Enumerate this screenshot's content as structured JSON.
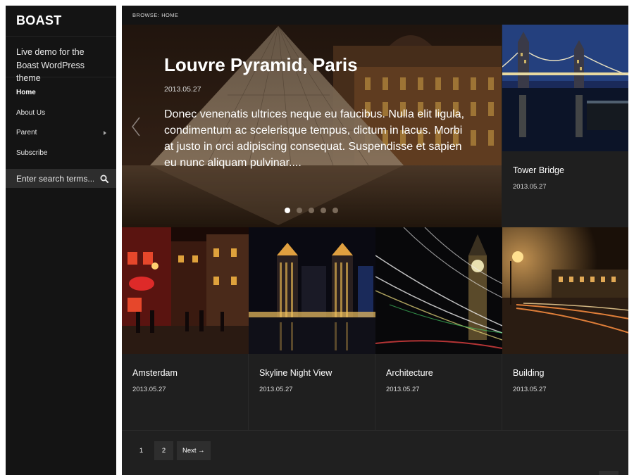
{
  "site": {
    "title": "BOAST",
    "description": "Live demo for the Boast WordPress theme"
  },
  "menu": {
    "items": [
      {
        "label": "Home"
      },
      {
        "label": "About Us"
      },
      {
        "label": "Parent"
      },
      {
        "label": "Subscribe"
      }
    ]
  },
  "search": {
    "placeholder": "Enter search terms...",
    "icon": "search-icon"
  },
  "breadcrumb": {
    "label": "Browse:",
    "current": "Home"
  },
  "featured": {
    "title": "Louvre Pyramid, Paris",
    "date": "2013.05.27",
    "excerpt": "Donec venenatis ultrices neque eu faucibus. Nulla elit ligula, condimentum ac scelerisque tempus, dictum in lacus. Morbi at justo in orci adipiscing consequat. Suspendisse et sapien eu nunc aliquam pulvinar....",
    "slide_count": 5,
    "active_slide": 1
  },
  "posts": [
    {
      "title": "Tower Bridge",
      "date": "2013.05.27"
    },
    {
      "title": "Amsterdam",
      "date": "2013.05.27"
    },
    {
      "title": "Skyline Night View",
      "date": "2013.05.27"
    },
    {
      "title": "Architecture",
      "date": "2013.05.27"
    },
    {
      "title": "Building",
      "date": "2013.05.27"
    }
  ],
  "pagination": {
    "pages": [
      "1",
      "2"
    ],
    "next_label": "Next →"
  },
  "colors": {
    "sidebar_bg": "#141414",
    "main_bg": "#202020",
    "search_bg": "#2d2d2d"
  }
}
